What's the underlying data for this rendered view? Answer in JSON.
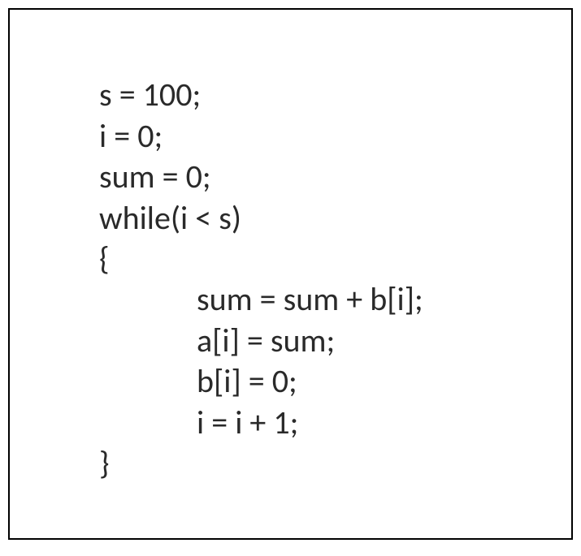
{
  "code": {
    "line1": "s = 100;",
    "line2": "i = 0;",
    "line3": "sum = 0;",
    "line4": "while(i < s)",
    "line5": "{",
    "line6": "sum = sum + b[i];",
    "line7": "a[i] = sum;",
    "line8": "b[i] = 0;",
    "line9": "i = i + 1;",
    "line10": "}"
  }
}
